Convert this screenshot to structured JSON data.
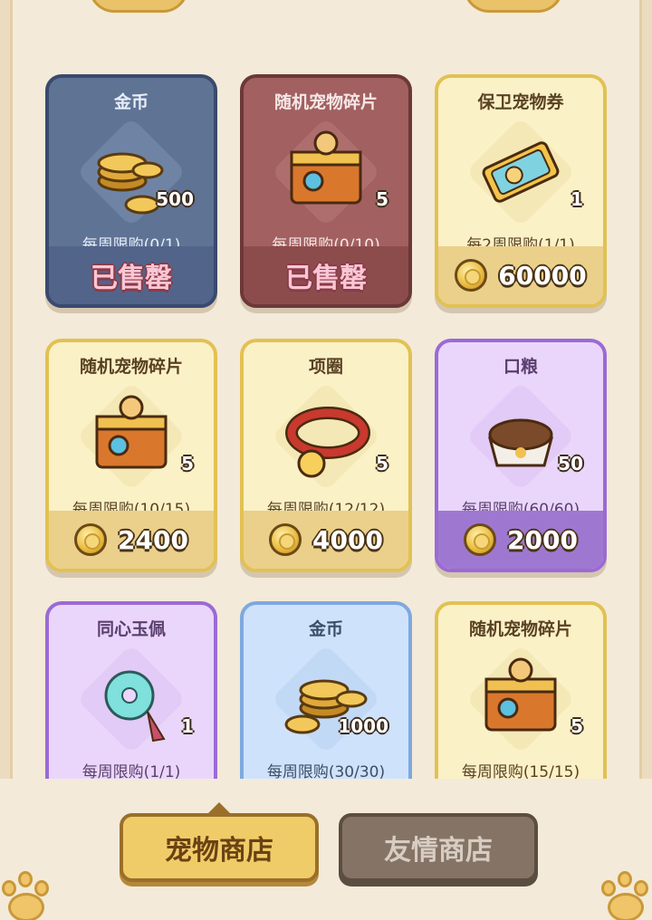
{
  "cards": [
    {
      "title": "金币",
      "qty": "500",
      "limit": "每周限购(0/1)",
      "footer": "已售罄",
      "theme": "blue",
      "icon": "gold-coins-icon"
    },
    {
      "title": "随机宠物碎片",
      "qty": "5",
      "limit": "每周限购(0/10)",
      "footer": "已售罄",
      "theme": "red",
      "icon": "cat-chest-icon"
    },
    {
      "title": "保卫宠物券",
      "qty": "1",
      "limit": "每2周限购(1/1)",
      "price": "60000",
      "theme": "gold",
      "icon": "pet-ticket-icon"
    },
    {
      "title": "随机宠物碎片",
      "qty": "5",
      "limit": "每周限购(10/15)",
      "price": "2400",
      "theme": "gold",
      "icon": "cat-chest-icon"
    },
    {
      "title": "项圈",
      "qty": "5",
      "limit": "每周限购(12/12)",
      "price": "4000",
      "theme": "gold",
      "icon": "collar-icon"
    },
    {
      "title": "口粮",
      "qty": "50",
      "limit": "每周限购(60/60)",
      "price": "2000",
      "theme": "purple",
      "icon": "pet-food-bowl-icon"
    },
    {
      "title": "同心玉佩",
      "qty": "1",
      "limit": "每周限购(1/1)",
      "theme": "purple",
      "icon": "jade-pendant-icon"
    },
    {
      "title": "金币",
      "qty": "1000",
      "limit": "每周限购(30/30)",
      "theme": "sky",
      "icon": "gold-coins-icon"
    },
    {
      "title": "随机宠物碎片",
      "qty": "5",
      "limit": "每周限购(15/15)",
      "theme": "gold",
      "icon": "cat-chest-icon"
    }
  ],
  "tabs": {
    "pet_shop": "宠物商店",
    "friendship_shop": "友情商店"
  },
  "colors": {
    "blue": "#5f7395",
    "red": "#a26060",
    "gold": "#fbf1c6",
    "purple": "#ead6fa",
    "sky": "#cfe2fb",
    "active_tab": "#f0cc68",
    "inactive_tab": "#857466"
  }
}
